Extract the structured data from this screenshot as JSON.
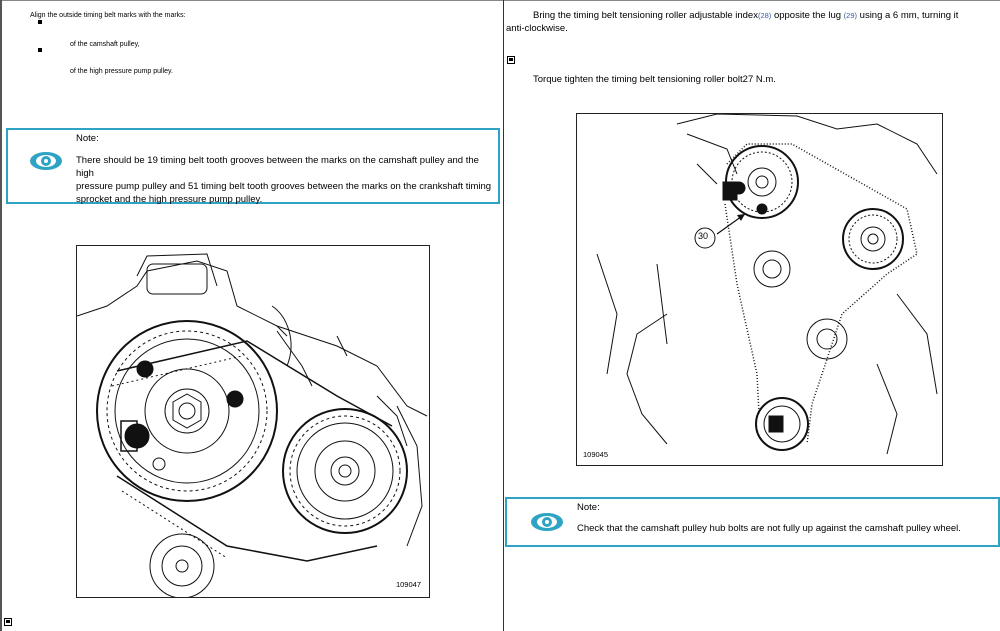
{
  "left": {
    "intro": "Align the outside timing belt marks with the marks:",
    "bullets": [
      "of the camshaft pulley,",
      "of the high pressure pump pulley."
    ],
    "note": {
      "title": "Note:",
      "lines": [
        "There should be 19 timing belt tooth grooves between the marks on the camshaft pulley and the high",
        "pressure pump pulley and 51 timing belt tooth grooves between the marks on the crankshaft timing",
        "sprocket and the high pressure pump pulley."
      ]
    },
    "figure_id": "109047"
  },
  "right": {
    "step1_a": "Bring the timing belt tensioning roller adjustable index",
    "step1_ref1": "(28)",
    "step1_b": " opposite the lug ",
    "step1_ref2": "(29)",
    "step1_c": " using a 6  mm,  turning it",
    "step1_line2": "anti-clockwise.",
    "step2": "Torque tighten the timing belt tensioning roller bolt27  N.m.",
    "figure_id": "109045",
    "callout": "30",
    "note": {
      "title": "Note:",
      "body": "Check that the camshaft pulley hub bolts are not fully up against the camshaft pulley wheel."
    }
  },
  "colors": {
    "accent": "#2ea3c4",
    "ref_link": "#3b5ba5"
  },
  "icons": [
    "eye-note-icon",
    "checkbox-icon",
    "bullet-square-icon"
  ]
}
